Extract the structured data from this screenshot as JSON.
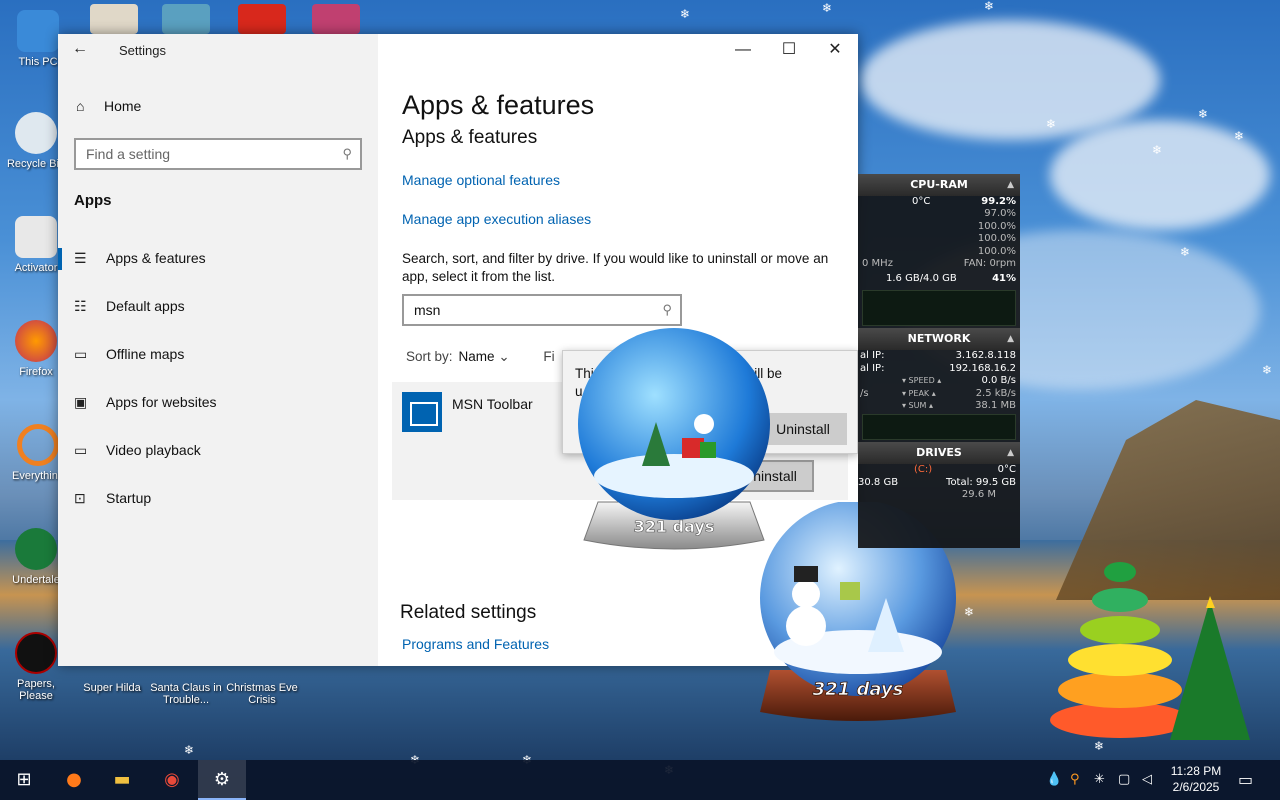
{
  "desktop": {
    "icons": [
      {
        "label": "This PC"
      },
      {
        "label": "Recycle Bin"
      },
      {
        "label": "Activator"
      },
      {
        "label": "Firefox"
      },
      {
        "label": "Everything"
      },
      {
        "label": "Undertale"
      },
      {
        "label": "Papers, Please"
      },
      {
        "label": "Super Hilda"
      },
      {
        "label": "Santa Claus in Trouble..."
      },
      {
        "label": "Christmas Eve Crisis"
      }
    ],
    "globe_text": "321 days"
  },
  "window": {
    "title": "Settings",
    "back_icon": "←",
    "minimize": "—",
    "maximize": "☐",
    "close": "✕"
  },
  "sidebar": {
    "home": "Home",
    "search_placeholder": "Find a setting",
    "section": "Apps",
    "items": [
      {
        "label": "Apps & features",
        "icon": "list-icon"
      },
      {
        "label": "Default apps",
        "icon": "default-apps-icon"
      },
      {
        "label": "Offline maps",
        "icon": "map-icon"
      },
      {
        "label": "Apps for websites",
        "icon": "web-apps-icon"
      },
      {
        "label": "Video playback",
        "icon": "video-icon"
      },
      {
        "label": "Startup",
        "icon": "startup-icon"
      }
    ]
  },
  "main": {
    "heading": "Apps & features",
    "subheading": "Apps & features",
    "link_optional": "Manage optional features",
    "link_aliases": "Manage app execution aliases",
    "description": "Search, sort, and filter by drive. If you would like to uninstall or move an app, select it from the list.",
    "filter_value": "msn",
    "sort_label": "Sort by:",
    "sort_value": "Name",
    "filter_label": "Fi",
    "app_name": "MSN Toolbar",
    "uninstall_label": "Uninstall",
    "popup_text_a": "Thi",
    "popup_text_b": "vill be",
    "popup_text_c": "u",
    "popup_button": "Uninstall",
    "related_heading": "Related settings",
    "related_link": "Programs and Features"
  },
  "monitor": {
    "cpu_title": "CPU-RAM",
    "cpu_temp": "0°C",
    "cpu_total": "99.2%",
    "cores": [
      "97.0%",
      "100.0%",
      "100.0%",
      "100.0%"
    ],
    "freq": "0 MHz",
    "fan": "FAN: 0rpm",
    "ram": "1.6 GB/4.0 GB",
    "ram_pct": "41%",
    "net_title": "NETWORK",
    "ip1_label": "al IP:",
    "ip1": "3.162.8.118",
    "ip2_label": "al IP:",
    "ip2": "192.168.16.2",
    "speed_label": "▾ SPEED ▴",
    "speed": "0.0 B/s",
    "peak_label": "▾ PEAK ▴",
    "peak_left": "/s",
    "peak": "2.5 kB/s",
    "sum_label": "▾ SUM ▴",
    "sum": "38.1 MB",
    "drives_title": "DRIVES",
    "drive_c": "(C:)",
    "drive_temp": "0°C",
    "drive_free": "30.8 GB",
    "drive_total": "Total: 99.5 GB",
    "drive_io": "29.6 M"
  },
  "taskbar": {
    "time": "11:28 PM",
    "date": "2/6/2025"
  }
}
